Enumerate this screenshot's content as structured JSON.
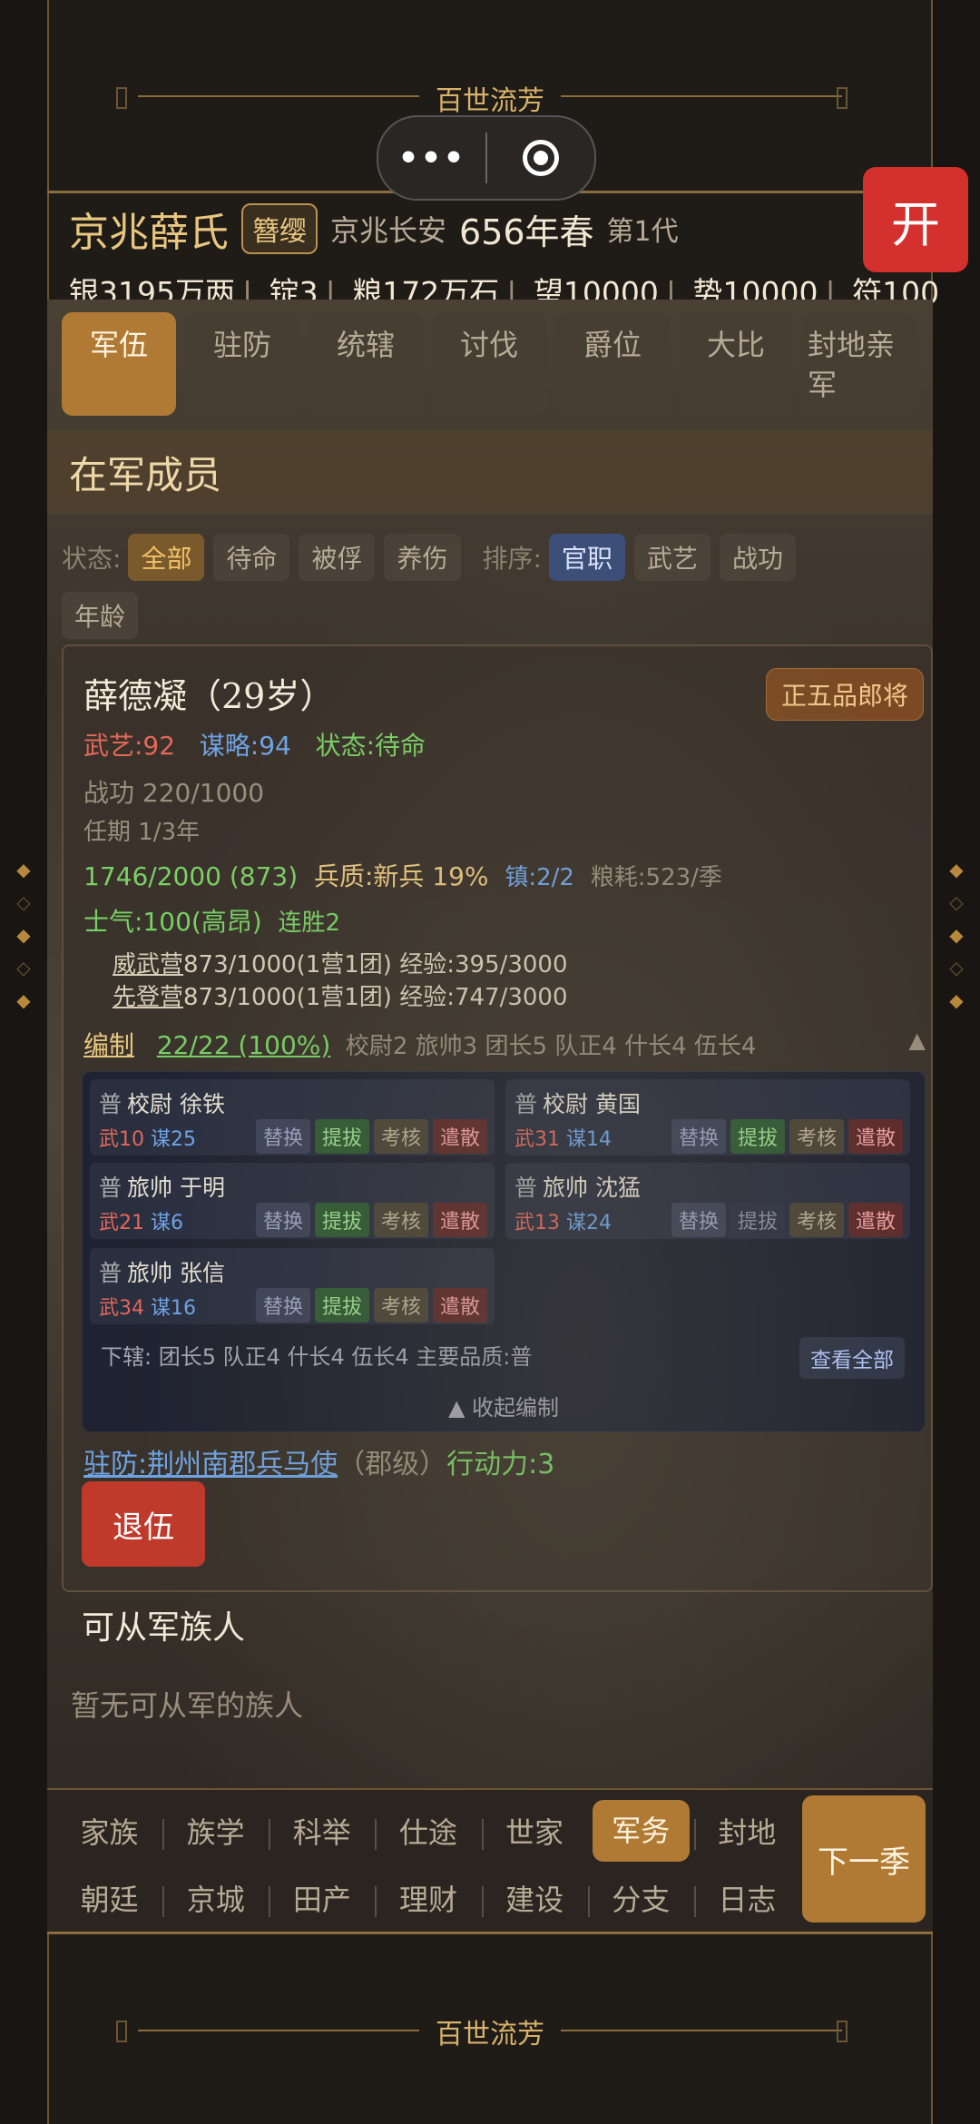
{
  "banner": {
    "title": "百世流芳"
  },
  "miniapp": {
    "more": "•••"
  },
  "open_button": "开",
  "family": {
    "name": "京兆薛氏",
    "badge": "簪缨",
    "place": "京兆长安",
    "year": "656年春",
    "generation": "第1代"
  },
  "resources": [
    "银3195万两",
    "锭3",
    "粮172万石",
    "望10000",
    "势10000",
    "符100"
  ],
  "tabs": [
    {
      "label": "军伍",
      "active": true
    },
    {
      "label": "驻防"
    },
    {
      "label": "统辖"
    },
    {
      "label": "讨伐"
    },
    {
      "label": "爵位"
    },
    {
      "label": "大比"
    },
    {
      "label": "封地亲军"
    }
  ],
  "section_title": "在军成员",
  "filters": {
    "status_label": "状态:",
    "status": [
      "全部",
      "待命",
      "被俘",
      "养伤"
    ],
    "sort_label": "排序:",
    "sort": [
      "官职",
      "武艺",
      "战功",
      "年龄"
    ]
  },
  "member": {
    "name": "薛德凝（29岁）",
    "rank": "正五品郎将",
    "martial": "武艺:92",
    "strategy": "谋略:94",
    "status": "状态:待命",
    "merit": "战功 220/1000",
    "term": "任期 1/3年",
    "troops": "1746/2000 (873)",
    "quality": "兵质:新兵 19%",
    "garrison_count": "镇:2/2",
    "grain": "粮耗:523/季",
    "morale": "士气:100(高昂)",
    "streak": "连胜2",
    "units": [
      {
        "name": "威武营",
        "info": "873/1000(1营1团) 经验:395/3000"
      },
      {
        "name": "先登营",
        "info": "873/1000(1营1团) 经验:747/3000"
      }
    ],
    "org_label": "编制",
    "org_value": "22/22 (100%)",
    "org_detail": "校尉2 旅帅3 团长5 队正4 什长4 伍长4",
    "org_toggle": "▲",
    "garrison": "驻防:荆州南郡兵马使",
    "garrison_level": "（郡级）",
    "action": "行动力:3",
    "retire": "退伍"
  },
  "officers": [
    {
      "tier": "普",
      "title": "校尉",
      "name": "徐铁",
      "wu": "武10",
      "mou": "谋25",
      "promote_enabled": true
    },
    {
      "tier": "普",
      "title": "校尉",
      "name": "黄国",
      "wu": "武31",
      "mou": "谋14",
      "promote_enabled": true
    },
    {
      "tier": "普",
      "title": "旅帅",
      "name": "于明",
      "wu": "武21",
      "mou": "谋6",
      "promote_enabled": true
    },
    {
      "tier": "普",
      "title": "旅帅",
      "name": "沈猛",
      "wu": "武13",
      "mou": "谋24",
      "promote_enabled": false
    },
    {
      "tier": "普",
      "title": "旅帅",
      "name": "张信",
      "wu": "武34",
      "mou": "谋16",
      "promote_enabled": true
    }
  ],
  "officer_actions": {
    "swap": "替换",
    "promote": "提拔",
    "exam": "考核",
    "dismiss": "遣散"
  },
  "roster_footer": "下辖: 团长5 队正4 什长4 伍长4   主要品质:普",
  "view_all": "查看全部",
  "collapse": "▲ 收起编制",
  "eligible": {
    "title": "可从军族人",
    "empty": "暂无可从军的族人"
  },
  "nav": {
    "row1": [
      "家族",
      "族学",
      "科举",
      "仕途",
      "世家",
      "军务",
      "封地"
    ],
    "row2": [
      "朝廷",
      "京城",
      "田产",
      "理财",
      "建设",
      "分支",
      "日志"
    ],
    "active": "军务",
    "next": "下一季"
  },
  "colors": {
    "accent": "#b07a35",
    "danger": "#c0392b",
    "sort_active": "#3a4e7a"
  }
}
